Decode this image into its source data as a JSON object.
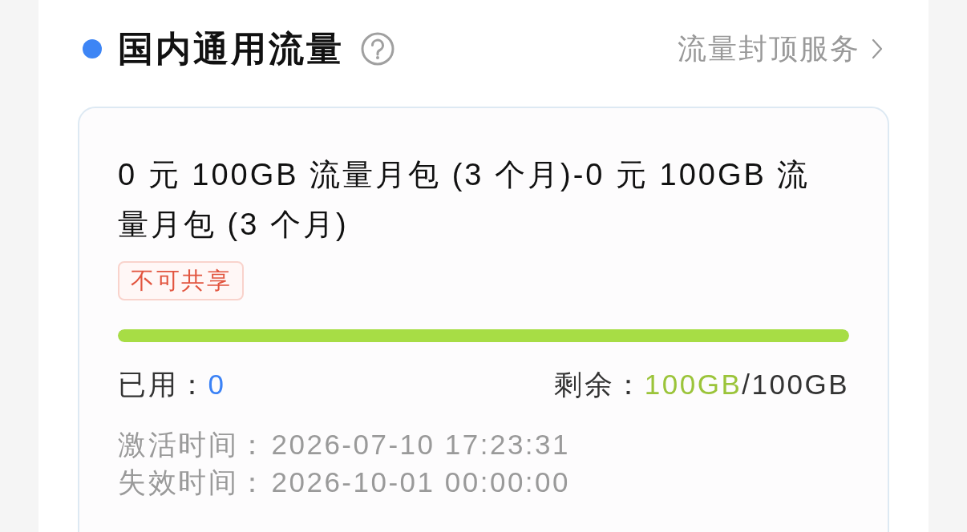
{
  "section": {
    "title": "国内通用流量",
    "link": "流量封顶服务"
  },
  "package": {
    "name": "0 元 100GB 流量月包 (3 个月)-0 元 100GB 流量月包 (3 个月)",
    "tags": [
      "不可共享"
    ],
    "progress": {
      "level": 1
    },
    "used": {
      "label": "已用：",
      "value": "0"
    },
    "remaining": {
      "label": "剩余：",
      "value": "100GB",
      "total": "/100GB"
    },
    "dates": [
      {
        "label": "激活时间：",
        "value": "2026-07-10 17:23:31"
      },
      {
        "label": "失效时间：",
        "value": "2026-10-01 00:00:00"
      }
    ]
  }
}
